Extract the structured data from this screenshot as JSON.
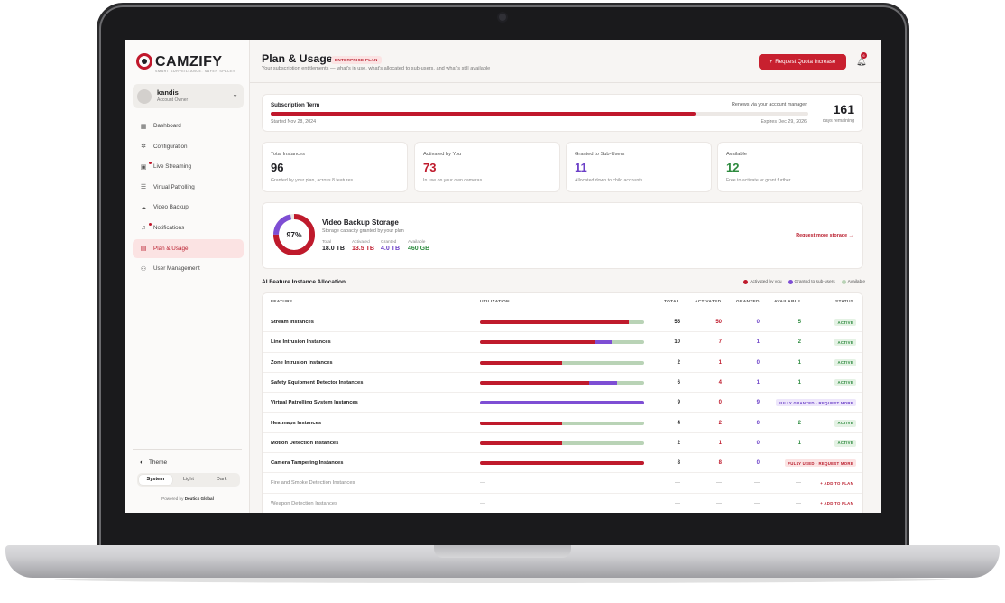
{
  "brand": {
    "name": "CAMZIFY",
    "tagline": "SMART SURVEILLANCE. SAFER SPACES",
    "color": "#c0182c"
  },
  "user": {
    "name": "kandis",
    "role": "Account Owner"
  },
  "sidebar": {
    "items": [
      {
        "label": "Dashboard",
        "icon": "grid-icon"
      },
      {
        "label": "Configuration",
        "icon": "gear-icon"
      },
      {
        "label": "Live Streaming",
        "icon": "video-icon"
      },
      {
        "label": "Virtual Patrolling",
        "icon": "layers-icon"
      },
      {
        "label": "Video Backup",
        "icon": "cloud-icon"
      },
      {
        "label": "Notifications",
        "icon": "bell-icon"
      },
      {
        "label": "Plan & Usage",
        "icon": "document-icon",
        "active": true
      },
      {
        "label": "User Management",
        "icon": "users-icon"
      }
    ],
    "theme_label": "Theme",
    "theme_options": [
      "System",
      "Light",
      "Dark"
    ],
    "theme_selected": "System",
    "powered_by_prefix": "Powered by",
    "powered_by_name": "Deutics Global"
  },
  "header": {
    "title": "Plan & Usage",
    "badge": "ENTERPRISE PLAN",
    "subtitle": "Your subscription entitlements — what's in use, what's allocated to sub-users, and what's still available",
    "request_button": "Request Quota Increase",
    "notification_count": "6"
  },
  "term": {
    "title": "Subscription Term",
    "renews": "Renews via your account manager",
    "started": "Started Nov 28, 2024",
    "expires": "Expires Dec 29, 2026",
    "days": "161",
    "days_label": "days remaining",
    "progress": 0.79
  },
  "stats": [
    {
      "label": "Total Instances",
      "value": "96",
      "sub": "Granted by your plan, across 8 features",
      "color": "#1f1f23"
    },
    {
      "label": "Activated by You",
      "value": "73",
      "sub": "In use on your own cameras",
      "color": "#bf1a2c"
    },
    {
      "label": "Granted to Sub-Users",
      "value": "11",
      "sub": "Allocated down to child accounts",
      "color": "#6b3fc7"
    },
    {
      "label": "Available",
      "value": "12",
      "sub": "Free to activate or grant further",
      "color": "#2d8a3e"
    }
  ],
  "backup": {
    "percent": "97%",
    "percent_value": 0.97,
    "activated_fraction": 0.75,
    "granted_fraction": 0.22,
    "title": "Video Backup Storage",
    "subtitle": "Storage capacity granted by your plan",
    "total_label": "Total",
    "total": "18.0 TB",
    "activated_label": "Activated",
    "activated": "13.5 TB",
    "granted_label": "Granted",
    "granted": "4.0 TB",
    "available_label": "Available",
    "available": "460 GB",
    "link": "Request more storage →"
  },
  "allocation": {
    "title": "AI Feature Instance Allocation",
    "legend": [
      "Activated by you",
      "Granted to sub-users",
      "Available"
    ],
    "legend_colors": [
      "#bf1a2c",
      "#7e4ed4",
      "#b9d3b6"
    ],
    "columns": [
      "FEATURE",
      "UTILIZATION",
      "TOTAL",
      "ACTIVATED",
      "GRANTED",
      "AVAILABLE",
      "STATUS"
    ],
    "rows": [
      {
        "feature": "Stream Instances",
        "total": 55,
        "activated": 50,
        "granted": 0,
        "available": 5,
        "status": "ACTIVE",
        "kind": "active"
      },
      {
        "feature": "Line Intrusion Instances",
        "total": 10,
        "activated": 7,
        "granted": 1,
        "available": 2,
        "status": "ACTIVE",
        "kind": "active"
      },
      {
        "feature": "Zone Intrusion Instances",
        "total": 2,
        "activated": 1,
        "granted": 0,
        "available": 1,
        "status": "ACTIVE",
        "kind": "active"
      },
      {
        "feature": "Safety Equipment Detector Instances",
        "total": 6,
        "activated": 4,
        "granted": 1,
        "available": 1,
        "status": "ACTIVE",
        "kind": "active"
      },
      {
        "feature": "Virtual Patrolling System Instances",
        "total": 9,
        "activated": 0,
        "granted": 9,
        "available": 0,
        "status": "FULLY GRANTED · REQUEST MORE",
        "kind": "granted"
      },
      {
        "feature": "Heatmaps Instances",
        "total": 4,
        "activated": 2,
        "granted": 0,
        "available": 2,
        "status": "ACTIVE",
        "kind": "active"
      },
      {
        "feature": "Motion Detection Instances",
        "total": 2,
        "activated": 1,
        "granted": 0,
        "available": 1,
        "status": "ACTIVE",
        "kind": "active"
      },
      {
        "feature": "Camera Tampering Instances",
        "total": 8,
        "activated": 8,
        "granted": 0,
        "available": 0,
        "status": "FULLY USED · REQUEST MORE",
        "kind": "used"
      },
      {
        "feature": "Fire and Smoke Detection Instances",
        "total": "—",
        "activated": "—",
        "granted": "—",
        "available": "—",
        "status": "+ ADD TO PLAN",
        "kind": "add"
      },
      {
        "feature": "Weapon Detection Instances",
        "total": "—",
        "activated": "—",
        "granted": "—",
        "available": "—",
        "status": "+ ADD TO PLAN",
        "kind": "add"
      }
    ]
  }
}
